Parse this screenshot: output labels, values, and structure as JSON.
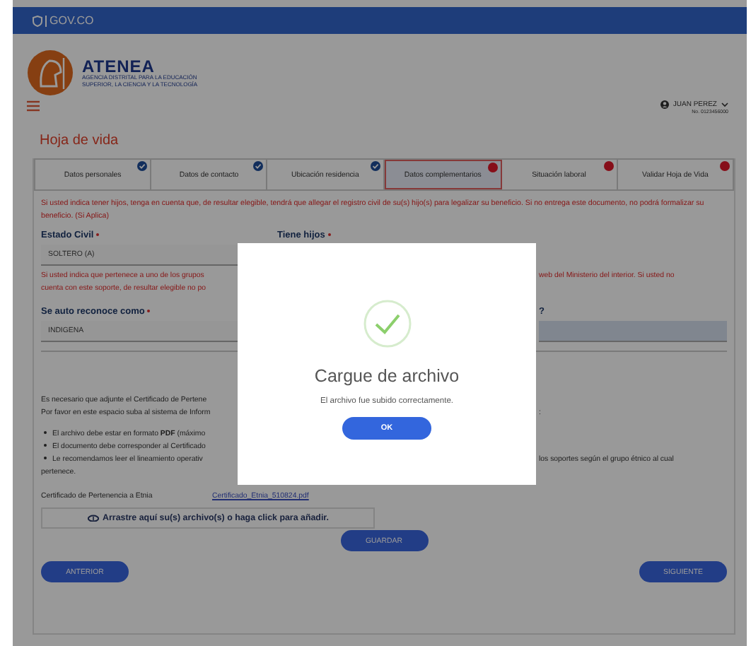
{
  "top_bar": {
    "brand": "GOV.CO"
  },
  "header": {
    "logo_title": "ATENEA",
    "logo_subtitle": [
      "AGENCIA DISTRITAL PARA LA EDUCACIÓN",
      "SUPERIOR, LA CIENCIA Y LA TECNOLOGÍA"
    ],
    "user_name": "JUAN PEREZ",
    "user_id": "No. 0123456000"
  },
  "page_title": "Hoja de vida",
  "tabs": [
    {
      "label": "Datos personales",
      "kind": "done",
      "selected": false
    },
    {
      "label": "Datos de contacto",
      "kind": "done",
      "selected": false
    },
    {
      "label": "Ubicación residencia",
      "kind": "done",
      "selected": false
    },
    {
      "label": "Datos complementarios",
      "kind": "pending",
      "selected": true
    },
    {
      "label": "Situación laboral",
      "kind": "pending",
      "selected": false
    },
    {
      "label": "Validar Hoja de Vida",
      "kind": "pending",
      "selected": false
    }
  ],
  "warning_children": "Si usted indica tener hijos, tenga en cuenta que, de resultar elegible, tendrá que allegar el registro civil de su(s) hijo(s) para legalizar su beneficio. Si no entrega este documento, no podrá formalizar su beneficio. (Si Aplica)",
  "civil_status": {
    "label": "Estado Civil",
    "value": "SOLTERO (A)",
    "right_label": "Tiene hijos"
  },
  "warning_ethnic": [
    {
      "left": "Si usted indica que pertenece a uno de  los grupos",
      "right": "web del Ministerio del interior. Si usted no"
    },
    {
      "left": "cuenta con este soporte, de resultar elegible no po"
    }
  ],
  "ethnic": {
    "label": "Se auto reconoce como",
    "value": "INDIGENA",
    "right_label_end": "?",
    "right_field_disabled": true
  },
  "info_lines": [
    {
      "left": "Es necesario que adjunte el Certificado de Pertene"
    },
    {
      "left": "Por favor en este espacio suba al sistema de Inform",
      "right": ":"
    }
  ],
  "bullets": [
    {
      "left": "El archivo debe estar en formato **PDF** (máximo"
    },
    {
      "left": "El documento debe corresponder al Certificado"
    },
    {
      "left": "Le recomendamos leer el lineamiento operativ",
      "right": "los soportes según el grupo étnico al cual"
    }
  ],
  "bullet_tail": "pertenece.",
  "certificate": {
    "label": "Certificado de Pertenencia a Etnia",
    "file": "Certificado_Etnia_510824.pdf"
  },
  "dropzone": "Arrastre aquí su(s) archivo(s) o haga click para añadir.",
  "save_button": "GUARDAR",
  "nav_buttons": {
    "previous": "ANTERIOR",
    "next": "SIGUIENTE"
  },
  "modal": {
    "title": "Cargue de archivo",
    "message": "El archivo fue subido correctamente.",
    "button": "OK"
  }
}
